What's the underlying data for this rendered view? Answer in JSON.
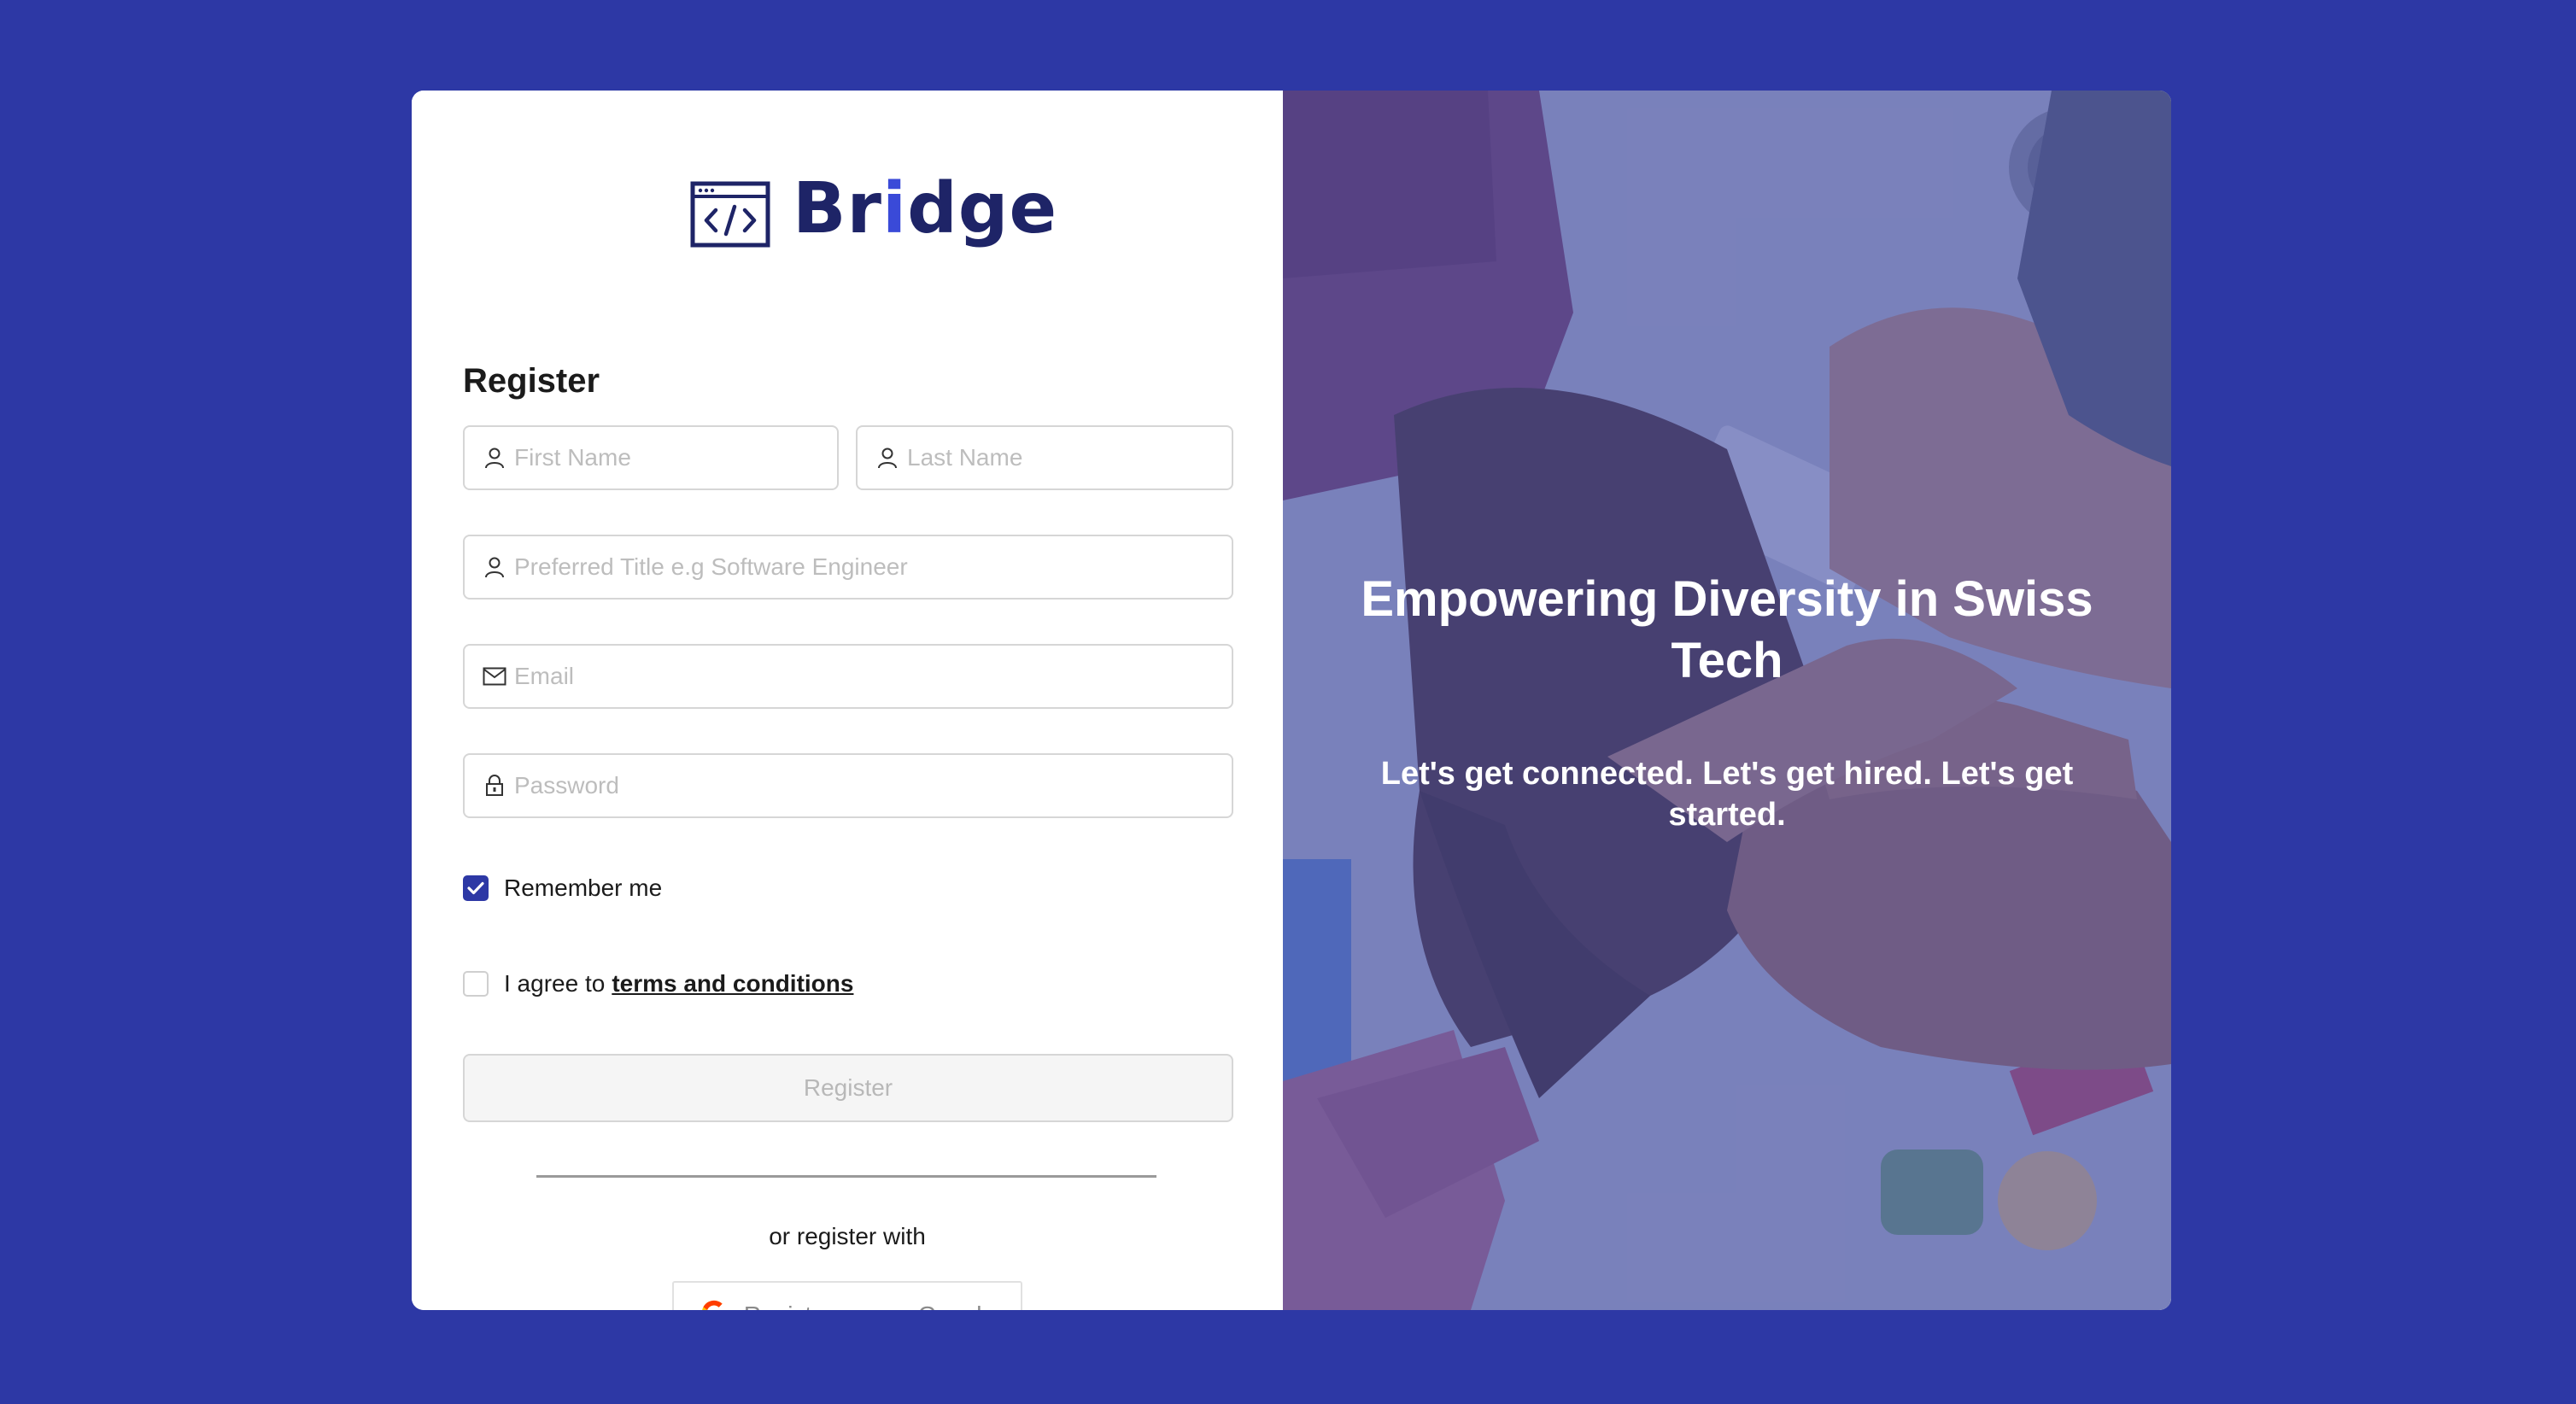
{
  "brand": {
    "name_part1": "Br",
    "name_part2": "i",
    "name_part3": "dge",
    "logo_icon": "code-window-icon"
  },
  "form": {
    "title": "Register",
    "first_name": {
      "placeholder": "First Name",
      "value": "",
      "icon": "user-icon"
    },
    "last_name": {
      "placeholder": "Last Name",
      "value": "",
      "icon": "user-icon"
    },
    "preferred_title": {
      "placeholder": "Preferred Title e.g Software Engineer",
      "value": "",
      "icon": "user-icon"
    },
    "email": {
      "placeholder": "Email",
      "value": "",
      "icon": "mail-icon"
    },
    "password": {
      "placeholder": "Password",
      "value": "",
      "icon": "lock-icon"
    },
    "remember_me": {
      "label": "Remember me",
      "checked": true
    },
    "agree": {
      "label_prefix": "I agree to",
      "link_text": "terms and conditions",
      "checked": false
    },
    "register_button": "Register",
    "or_text": "or register with",
    "google_button": "Registrarse con Google"
  },
  "hero": {
    "headline": "Empowering Diversity in Swiss Tech",
    "subheadline": "Let's get connected. Let's get hired. Let's get started."
  },
  "colors": {
    "background": "#2d38a5",
    "accent": "#2d38a5",
    "brand_dark": "#1e2467",
    "brand_light": "#3a4ad8"
  }
}
